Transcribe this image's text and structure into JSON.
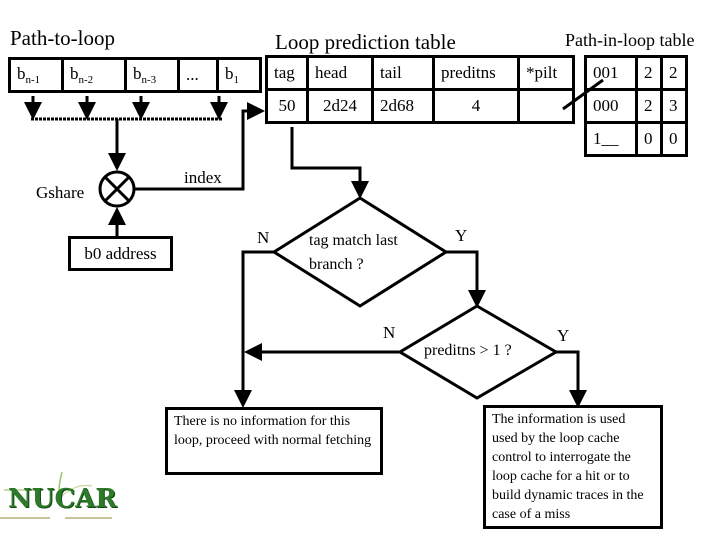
{
  "titles": {
    "path_to_loop": "Path-to-loop",
    "loop_prediction_table": "Loop prediction table",
    "path_in_loop_table": "Path-in-loop table"
  },
  "path_to_loop": {
    "cells": [
      {
        "base": "b",
        "sub": "n-1"
      },
      {
        "base": "b",
        "sub": "n-2"
      },
      {
        "base": "b",
        "sub": "n-3"
      },
      {
        "base": "...",
        "sub": ""
      },
      {
        "base": "b",
        "sub": "1"
      }
    ]
  },
  "loop_prediction_table": {
    "headers": [
      "tag",
      "head",
      "tail",
      "preditns",
      "*pilt"
    ],
    "row": [
      "50",
      "2d24",
      "2d68",
      "4",
      ""
    ]
  },
  "path_in_loop_table": {
    "rows": [
      [
        "001",
        "2",
        "2"
      ],
      [
        "000",
        "2",
        "3"
      ],
      [
        "1__",
        "0",
        "0"
      ]
    ]
  },
  "labels": {
    "gshare": "Gshare",
    "index": "index",
    "b0_address": "b0 address",
    "n1": "N",
    "y1": "Y",
    "n2": "N",
    "y2": "Y"
  },
  "decisions": {
    "tag_match": "tag match last branch ?",
    "tag_match_line1": "tag match last",
    "tag_match_line2": "branch ?",
    "preditns": "preditns > 1 ?"
  },
  "outcomes": {
    "no_info": "There is no information for this loop, proceed with normal fetching",
    "info_used": "The information is used used by the loop cache control to interrogate the loop cache for a hit or to build dynamic traces in the case of a miss"
  },
  "logo": {
    "text": "NUCAR",
    "color": "#2f7a2a"
  }
}
